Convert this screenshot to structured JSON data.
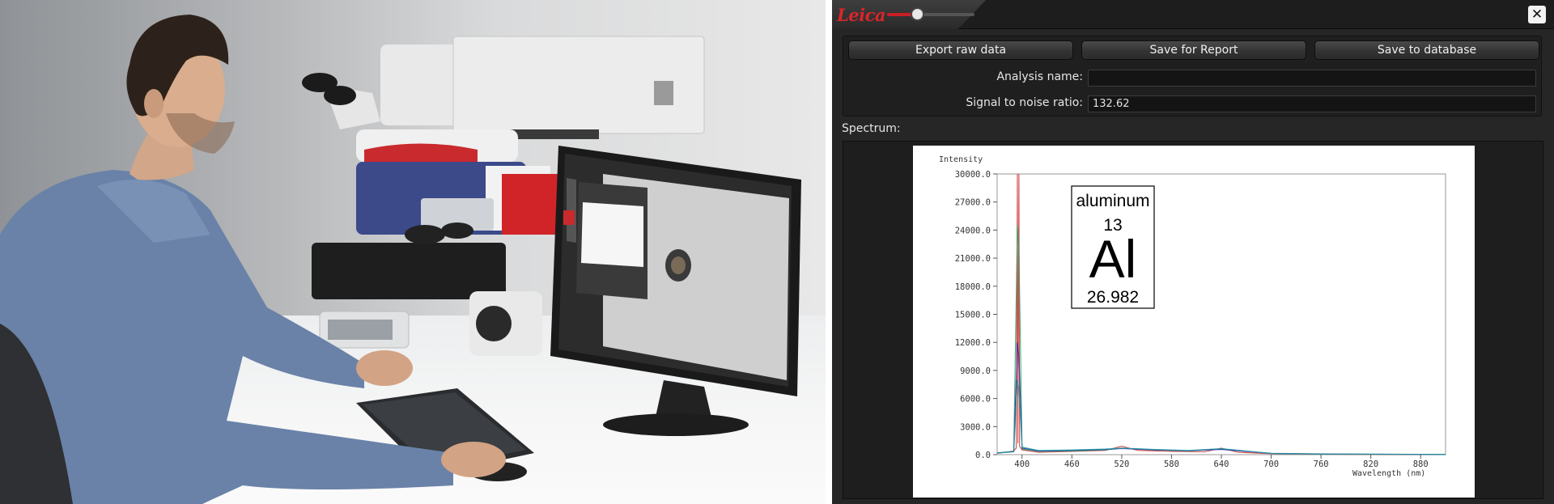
{
  "app": {
    "logo": "Leica",
    "slider_level": 0.34,
    "close_glyph": "✕"
  },
  "toolbar": {
    "export_label": "Export raw data",
    "report_label": "Save for Report",
    "database_label": "Save to database"
  },
  "form": {
    "analysis_name_label": "Analysis name:",
    "analysis_name_value": "",
    "snr_label": "Signal to noise ratio:",
    "snr_value": "132.62"
  },
  "spectrum": {
    "label": "Spectrum:"
  },
  "colors": {
    "accent": "#c81f25",
    "panel_bg": "#262626",
    "series_red": "#d03a3a",
    "series_green": "#2aa66a",
    "series_blue": "#2b2fa8",
    "series_teal": "#1f9aa0"
  },
  "element_card": {
    "name": "aluminum",
    "number": "13",
    "symbol": "Al",
    "mass": "26.982"
  },
  "chart_data": {
    "type": "line",
    "ylabel": "Intensity",
    "xlabel": "Wavelength (nm)",
    "xlim": [
      370,
      910
    ],
    "ylim": [
      0,
      30000
    ],
    "y_ticks": [
      "0.0",
      "3000.0",
      "6000.0",
      "9000.0",
      "12000.0",
      "15000.0",
      "18000.0",
      "21000.0",
      "24000.0",
      "27000.0",
      "30000.0"
    ],
    "x_ticks": [
      "400",
      "460",
      "520",
      "580",
      "640",
      "700",
      "760",
      "820",
      "880"
    ],
    "series": [
      {
        "x": [
          370,
          380,
          390,
          393,
          394.4,
          395,
          396.2,
          397,
          400,
          420,
          460,
          500,
          520,
          540,
          580,
          620,
          640,
          660,
          700,
          760,
          820,
          880,
          910
        ],
        "y": [
          150,
          250,
          400,
          700,
          30000,
          1200,
          30000,
          900,
          500,
          250,
          350,
          450,
          900,
          450,
          350,
          300,
          700,
          250,
          100,
          40,
          30,
          20,
          20
        ]
      },
      {
        "x": [
          370,
          390,
          394.4,
          396.2,
          400,
          420,
          460,
          500,
          520,
          560,
          600,
          640,
          680,
          700,
          760,
          820,
          880,
          910
        ],
        "y": [
          200,
          350,
          24500,
          22000,
          600,
          350,
          400,
          500,
          700,
          500,
          400,
          600,
          300,
          150,
          80,
          60,
          40,
          30
        ]
      },
      {
        "x": [
          370,
          390,
          394.4,
          396.2,
          400,
          420,
          460,
          500,
          520,
          560,
          600,
          640,
          680,
          700,
          760,
          820,
          880,
          910
        ],
        "y": [
          180,
          320,
          12000,
          10500,
          700,
          400,
          450,
          550,
          650,
          500,
          420,
          550,
          280,
          140,
          70,
          50,
          30,
          20
        ]
      },
      {
        "x": [
          370,
          390,
          394.4,
          396.2,
          400,
          420,
          460,
          500,
          520,
          560,
          600,
          640,
          680,
          700,
          760,
          820,
          880,
          910
        ],
        "y": [
          160,
          300,
          8000,
          7000,
          800,
          450,
          500,
          600,
          700,
          550,
          450,
          650,
          300,
          120,
          60,
          40,
          25,
          20
        ]
      }
    ]
  }
}
